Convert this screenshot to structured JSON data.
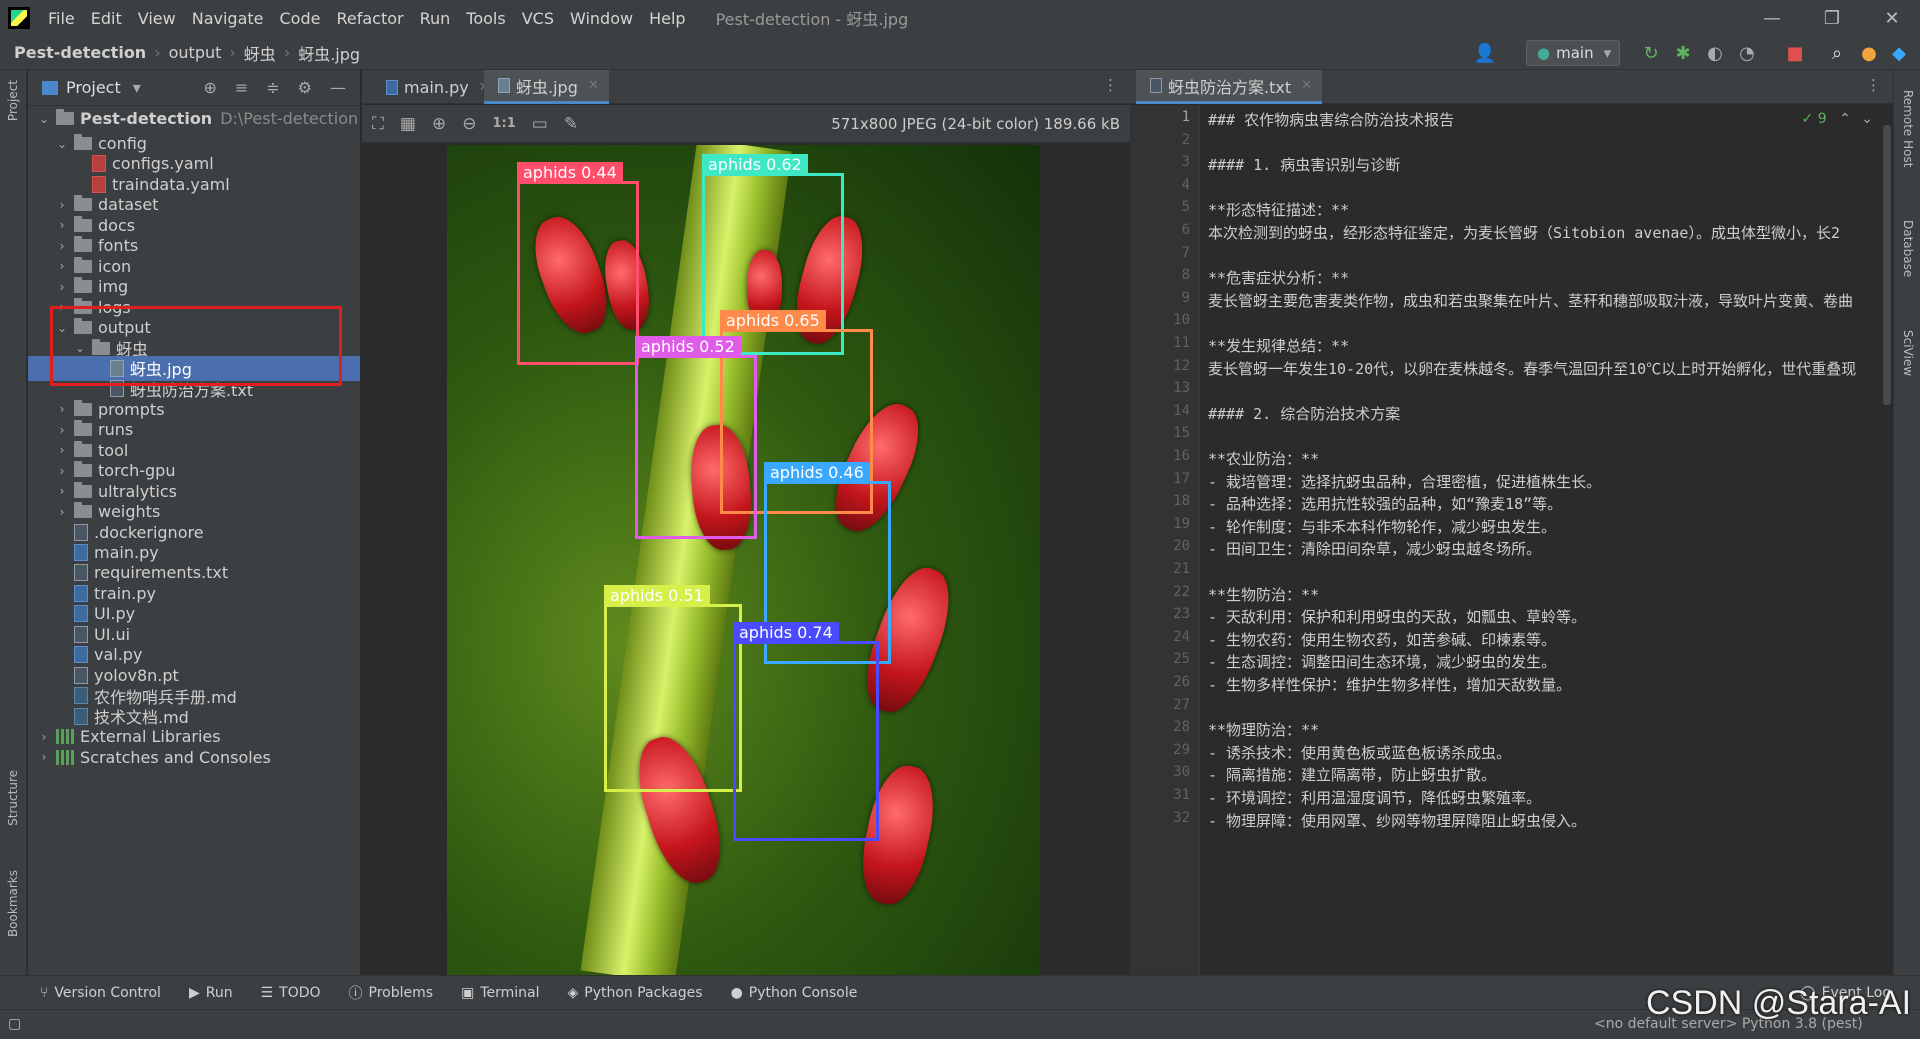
{
  "menu": {
    "items": [
      "File",
      "Edit",
      "View",
      "Navigate",
      "Code",
      "Refactor",
      "Run",
      "Tools",
      "VCS",
      "Window",
      "Help"
    ],
    "title": "Pest-detection - 蚜虫.jpg"
  },
  "nav": {
    "project": "Pest-detection",
    "crumb1": "output",
    "crumb2": "蚜虫",
    "crumb3": "蚜虫.jpg",
    "branch": "main"
  },
  "project_panel": {
    "title": "Project",
    "root": "Pest-detection",
    "root_path": "D:\\Pest-detection",
    "rows": [
      {
        "depth": 1,
        "arrow": "⌄",
        "type": "folder",
        "label": "config"
      },
      {
        "depth": 2,
        "arrow": "",
        "type": "yml",
        "label": "configs.yaml"
      },
      {
        "depth": 2,
        "arrow": "",
        "type": "yml",
        "label": "traindata.yaml"
      },
      {
        "depth": 1,
        "arrow": "›",
        "type": "folder",
        "label": "dataset"
      },
      {
        "depth": 1,
        "arrow": "›",
        "type": "folder",
        "label": "docs"
      },
      {
        "depth": 1,
        "arrow": "›",
        "type": "folder",
        "label": "fonts"
      },
      {
        "depth": 1,
        "arrow": "›",
        "type": "folder",
        "label": "icon"
      },
      {
        "depth": 1,
        "arrow": "›",
        "type": "folder",
        "label": "img"
      },
      {
        "depth": 1,
        "arrow": "›",
        "type": "folder",
        "label": "logs"
      },
      {
        "depth": 1,
        "arrow": "⌄",
        "type": "folder",
        "label": "output"
      },
      {
        "depth": 2,
        "arrow": "⌄",
        "type": "folder",
        "label": "蚜虫"
      },
      {
        "depth": 3,
        "arrow": "",
        "type": "img",
        "label": "蚜虫.jpg",
        "selected": true
      },
      {
        "depth": 3,
        "arrow": "",
        "type": "file",
        "label": "蚜虫防治方案.txt"
      },
      {
        "depth": 1,
        "arrow": "›",
        "type": "folder",
        "label": "prompts"
      },
      {
        "depth": 1,
        "arrow": "›",
        "type": "folder",
        "label": "runs"
      },
      {
        "depth": 1,
        "arrow": "›",
        "type": "folder",
        "label": "tool"
      },
      {
        "depth": 1,
        "arrow": "›",
        "type": "folder",
        "label": "torch-gpu"
      },
      {
        "depth": 1,
        "arrow": "›",
        "type": "folder",
        "label": "ultralytics"
      },
      {
        "depth": 1,
        "arrow": "›",
        "type": "folder",
        "label": "weights"
      },
      {
        "depth": 1,
        "arrow": "",
        "type": "file",
        "label": ".dockerignore"
      },
      {
        "depth": 1,
        "arrow": "",
        "type": "py",
        "label": "main.py"
      },
      {
        "depth": 1,
        "arrow": "",
        "type": "file",
        "label": "requirements.txt"
      },
      {
        "depth": 1,
        "arrow": "",
        "type": "py",
        "label": "train.py"
      },
      {
        "depth": 1,
        "arrow": "",
        "type": "py",
        "label": "UI.py"
      },
      {
        "depth": 1,
        "arrow": "",
        "type": "file",
        "label": "UI.ui"
      },
      {
        "depth": 1,
        "arrow": "",
        "type": "py",
        "label": "val.py"
      },
      {
        "depth": 1,
        "arrow": "",
        "type": "file",
        "label": "yolov8n.pt"
      },
      {
        "depth": 1,
        "arrow": "",
        "type": "md",
        "label": "农作物哨兵手册.md"
      },
      {
        "depth": 1,
        "arrow": "",
        "type": "md",
        "label": "技术文档.md"
      },
      {
        "depth": 0,
        "arrow": "›",
        "type": "lib",
        "label": "External Libraries"
      },
      {
        "depth": 0,
        "arrow": "›",
        "type": "lib",
        "label": "Scratches and Consoles"
      }
    ]
  },
  "tabs_left": [
    {
      "label": "main.py"
    },
    {
      "label": "蚜虫.jpg",
      "active": true
    }
  ],
  "tabs_right": [
    {
      "label": "蚜虫防治方案.txt",
      "active": true
    }
  ],
  "image": {
    "info": "571x800 JPEG (24-bit color) 189.66 kB",
    "zoom_label": "1:1"
  },
  "detections": [
    {
      "label": "aphids 0.44",
      "color": "#ff4d6b"
    },
    {
      "label": "aphids 0.62",
      "color": "#3ee8c5"
    },
    {
      "label": "aphids 0.65",
      "color": "#ff8a4a"
    },
    {
      "label": "aphids 0.52",
      "color": "#e05ce8"
    },
    {
      "label": "aphids 0.46",
      "color": "#3aa8ff"
    },
    {
      "label": "aphids 0.51",
      "color": "#d6ef4a"
    },
    {
      "label": "aphids 0.74",
      "color": "#4a4aff"
    }
  ],
  "editor": {
    "inspection": "✓ 9",
    "lines": [
      "### 农作物病虫害综合防治技术报告",
      "",
      "#### 1. 病虫害识别与诊断",
      "",
      "**形态特征描述：**",
      "本次检测到的蚜虫，经形态特征鉴定，为麦长管蚜（Sitobion avenae）。成虫体型微小，长2",
      "",
      "**危害症状分析：**",
      "麦长管蚜主要危害麦类作物，成虫和若虫聚集在叶片、茎秆和穗部吸取汁液，导致叶片变黄、卷曲",
      "",
      "**发生规律总结：**",
      "麦长管蚜一年发生10-20代，以卵在麦株越冬。春季气温回升至10℃以上时开始孵化，世代重叠现",
      "",
      "#### 2. 综合防治技术方案",
      "",
      "**农业防治：**",
      "- 栽培管理：选择抗蚜虫品种，合理密植，促进植株生长。",
      "- 品种选择：选用抗性较强的品种，如“豫麦18”等。",
      "- 轮作制度：与非禾本科作物轮作，减少蚜虫发生。",
      "- 田间卫生：清除田间杂草，减少蚜虫越冬场所。",
      "",
      "**生物防治：**",
      "- 天敌利用：保护和利用蚜虫的天敌，如瓢虫、草蛉等。",
      "- 生物农药：使用生物农药，如苦参碱、印楝素等。",
      "- 生态调控：调整田间生态环境，减少蚜虫的发生。",
      "- 生物多样性保护：维护生物多样性，增加天敌数量。",
      "",
      "**物理防治：**",
      "- 诱杀技术：使用黄色板或蓝色板诱杀成虫。",
      "- 隔离措施：建立隔离带，防止蚜虫扩散。",
      "- 环境调控：利用温湿度调节，降低蚜虫繁殖率。",
      "- 物理屏障：使用网罩、纱网等物理屏障阻止蚜虫侵入。"
    ]
  },
  "status": {
    "items": [
      "Version Control",
      "Run",
      "TODO",
      "Problems",
      "Terminal",
      "Python Packages",
      "Python Console"
    ],
    "event_log": "Event Log",
    "interpreter": "<no default server>   Python 3.8 (pest)"
  },
  "side": {
    "left": [
      "Project",
      "Structure",
      "Bookmarks"
    ],
    "right": [
      "Remote Host",
      "Database",
      "SciView"
    ]
  },
  "watermark": "CSDN @Stara-AI"
}
